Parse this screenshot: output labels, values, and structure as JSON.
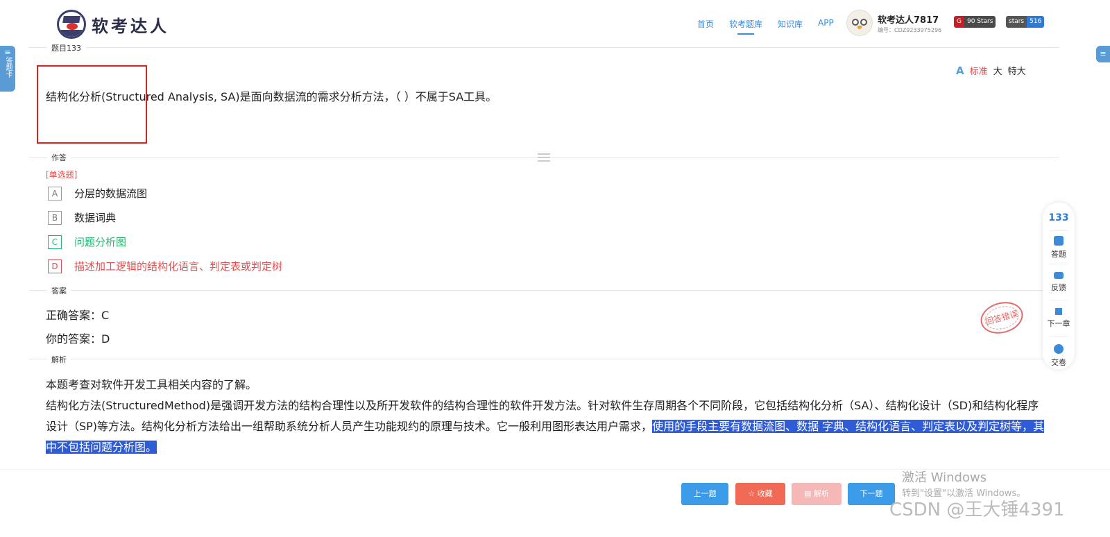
{
  "header": {
    "logo_text": "软考达人",
    "nav": [
      "首页",
      "软考题库",
      "知识库",
      "APP"
    ],
    "active_nav": "软考题库",
    "user_name": "软考达人7817",
    "user_id": "编号：CDZ9233975296",
    "badge_gitee_label": "G",
    "badge_gitee_value": "90 Stars",
    "badge_github_label": "stars",
    "badge_github_value": "516"
  },
  "sidebar": {
    "label": "答题卡"
  },
  "sections": {
    "question": "题目133",
    "answer_area": "作答",
    "answer": "答案",
    "analysis": "解析"
  },
  "question": {
    "text": "结构化分析(Structured Analysis, SA)是面向数据流的需求分析方法，（ ）不属于SA工具。",
    "type": "[单选题]",
    "options": [
      {
        "key": "A",
        "text": "分层的数据流图"
      },
      {
        "key": "B",
        "text": "数据词典"
      },
      {
        "key": "C",
        "text": "问题分析图"
      },
      {
        "key": "D",
        "text": "描述加工逻辑的结构化语言、判定表或判定树"
      }
    ]
  },
  "font_size": {
    "standard": "标准",
    "large": "大",
    "xlarge": "特大"
  },
  "answer": {
    "correct": "正确答案：C",
    "yours": "你的答案：D",
    "stamp": "回答错误"
  },
  "analysis": {
    "line1": "本题考查对软件开发工具相关内容的了解。",
    "para": "结构化方法(StructuredMethod)是强调开发方法的结构合理性以及所开发软件的结构合理性的软件开发方法。针对软件生存周期各个不同阶段，它包括结构化分析（SA）、结构化设计（SD)和结构化程序设计（SP)等方法。结构化分析方法给出一组帮助系统分析人员产生功能规约的原理与技术。它一般利用图形表达用户需求，",
    "highlight": "使用的手段主要有数据流图、数据 字典、结构化语言、判定表以及判定树等，其中不包括问题分析图。"
  },
  "side_panel": {
    "number": "133",
    "items": [
      "答题",
      "反馈",
      "下一章",
      "交卷"
    ]
  },
  "buttons": {
    "prev": "上一题",
    "favorite": "☆ 收藏",
    "analysis": "▤ 解析",
    "next": "下一题"
  },
  "watermark": {
    "line1": "激活 Windows",
    "line2": "转到\"设置\"以激活 Windows。",
    "csdn": "CSDN @王大锤4391"
  },
  "colors": {
    "accent": "#3b8bd6",
    "correct": "#2bb673",
    "wrong": "#e05050",
    "highlight": "#2e5bd6"
  }
}
